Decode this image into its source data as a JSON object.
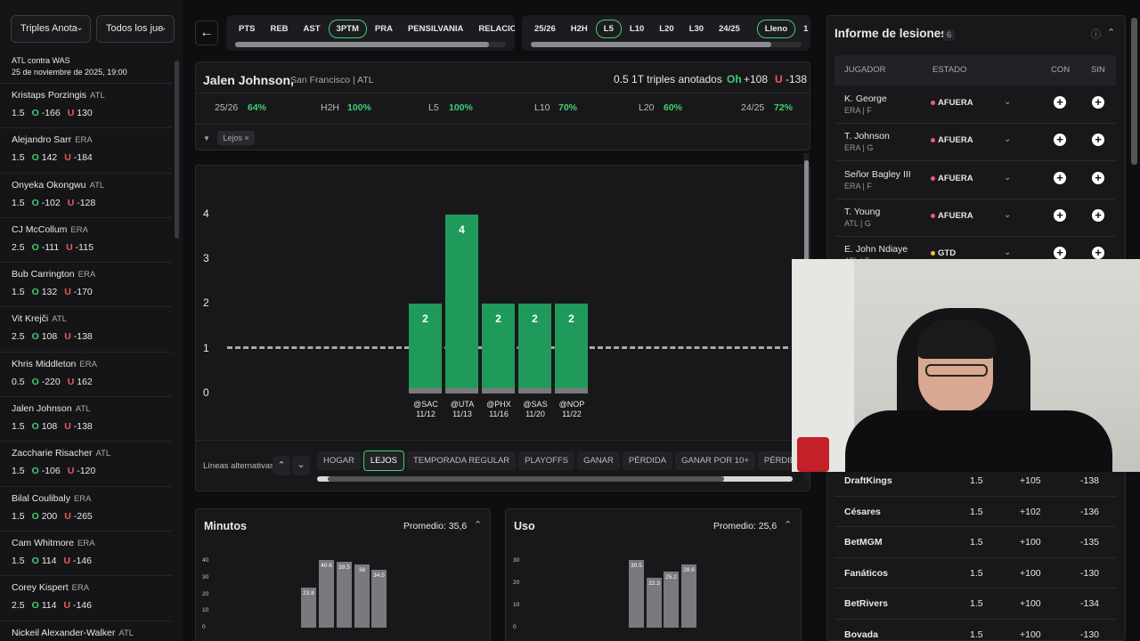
{
  "left": {
    "filter1": "Triples Anota",
    "filter2": "Todos los jue",
    "game": "ATL contra WAS",
    "game_time": "25 de noviembre de 2025, 19:00",
    "players": [
      {
        "name": "Kristaps Porzingis",
        "team": "ATL",
        "line": "1.5",
        "over": "-166",
        "under": "130"
      },
      {
        "name": "Alejandro Sarr",
        "team": "ERA",
        "line": "1.5",
        "over": "142",
        "under": "-184"
      },
      {
        "name": "Onyeka Okongwu",
        "team": "ATL",
        "line": "1.5",
        "over": "-102",
        "under": "-128"
      },
      {
        "name": "CJ McCollum",
        "team": "ERA",
        "line": "2.5",
        "over": "-111",
        "under": "-115"
      },
      {
        "name": "Bub Carrington",
        "team": "ERA",
        "line": "1.5",
        "over": "132",
        "under": "-170"
      },
      {
        "name": "Vit Krejči",
        "team": "ATL",
        "line": "2.5",
        "over": "108",
        "under": "-138"
      },
      {
        "name": "Khris Middleton",
        "team": "ERA",
        "line": "0.5",
        "over": "-220",
        "under": "162"
      },
      {
        "name": "Jalen Johnson",
        "team": "ATL",
        "line": "1.5",
        "over": "108",
        "under": "-138"
      },
      {
        "name": "Zaccharie Risacher",
        "team": "ATL",
        "line": "1.5",
        "over": "-106",
        "under": "-120"
      },
      {
        "name": "Bilal Coulibaly",
        "team": "ERA",
        "line": "1.5",
        "over": "200",
        "under": "-265"
      },
      {
        "name": "Cam Whitmore",
        "team": "ERA",
        "line": "1.5",
        "over": "114",
        "under": "-146"
      },
      {
        "name": "Corey Kispert",
        "team": "ERA",
        "line": "2.5",
        "over": "114",
        "under": "-146"
      },
      {
        "name": "Nickeil Alexander-Walker",
        "team": "ATL",
        "line": "",
        "over": "",
        "under": ""
      }
    ]
  },
  "stat_tabs": [
    "PTS",
    "REB",
    "AST",
    "3PTM",
    "PRA",
    "PENSILVANIA",
    "RELACIONES I"
  ],
  "stat_active": "3PTM",
  "range_tabs": [
    "25/26",
    "H2H",
    "L5",
    "L10",
    "L20",
    "L30",
    "24/25"
  ],
  "range_active": "L5",
  "mode_tabs": [
    "Lleno",
    "1 ho"
  ],
  "mode_active": "Lleno",
  "player": {
    "name": "Jalen Johnson,",
    "sub": "San Francisco | ATL",
    "prop": "0.5 1T triples anotados",
    "o_label": "Oh",
    "o_val": "+108",
    "u_label": "U",
    "u_val": "-138"
  },
  "hits": [
    {
      "k": "25/26",
      "v": "64%"
    },
    {
      "k": "H2H",
      "v": "100%"
    },
    {
      "k": "L5",
      "v": "100%"
    },
    {
      "k": "L10",
      "v": "70%"
    },
    {
      "k": "L20",
      "v": "60%"
    },
    {
      "k": "24/25",
      "v": "72%"
    }
  ],
  "active_filter": "Lejos",
  "filter_x": "×",
  "chart_data": {
    "type": "bar",
    "categories": [
      "@SAC 11/12",
      "@UTA 11/13",
      "@PHX 11/16",
      "@SAS 11/20",
      "@NOP 11/22"
    ],
    "values": [
      2,
      4,
      2,
      2,
      2
    ],
    "yticks": [
      "4",
      "3",
      "2",
      "1",
      "0"
    ],
    "ylim": [
      0,
      4
    ],
    "line": 0.5
  },
  "opp": [
    [
      "@SAC",
      "11/12"
    ],
    [
      "@UTA",
      "11/13"
    ],
    [
      "@PHX",
      "11/16"
    ],
    [
      "@SAS",
      "11/20"
    ],
    [
      "@NOP",
      "11/22"
    ]
  ],
  "alt_label": "Líneas alternativas",
  "split_tabs": [
    "HOGAR",
    "LEJOS",
    "TEMPORADA REGULAR",
    "PLAYOFFS",
    "GANAR",
    "PÉRDIDA",
    "GANAR POR 10+",
    "PÉRDIDA POR 10+"
  ],
  "split_active": "LEJOS",
  "minutes": {
    "title": "Minutos",
    "avg": "Promedio: 35,6",
    "values": [
      23.8,
      40.6,
      39.5,
      38,
      34.5
    ],
    "yticks": [
      "40",
      "30",
      "20",
      "10",
      "0"
    ]
  },
  "usage": {
    "title": "Uso",
    "avg": "Promedio: 25,6",
    "values": [
      30.5,
      22.3,
      25.2,
      28.6
    ],
    "yticks": [
      "30",
      "20",
      "10",
      "0"
    ]
  },
  "injury": {
    "title": "Informe de lesiones",
    "count": "6",
    "cols": [
      "JUGADOR",
      "ESTADO",
      "CON",
      "SIN"
    ],
    "rows": [
      {
        "name": "K. George",
        "team": "ERA | F",
        "status": "AFUERA",
        "color": "#f05a7a"
      },
      {
        "name": "T. Johnson",
        "team": "ERA | G",
        "status": "AFUERA",
        "color": "#f05a7a"
      },
      {
        "name": "Señor Bagley III",
        "team": "ERA | F",
        "status": "AFUERA",
        "color": "#f05a7a"
      },
      {
        "name": "T. Young",
        "team": "ATL | G",
        "status": "AFUERA",
        "color": "#f05a7a"
      },
      {
        "name": "E. John Ndiaye",
        "team": "ATL | F",
        "status": "GTD",
        "color": "#f0c040"
      }
    ]
  },
  "books": [
    {
      "name": "DraftKings",
      "line": "1.5",
      "over": "+105",
      "under": "-138"
    },
    {
      "name": "Césares",
      "line": "1.5",
      "over": "+102",
      "under": "-136"
    },
    {
      "name": "BetMGM",
      "line": "1.5",
      "over": "+100",
      "under": "-135"
    },
    {
      "name": "Fanáticos",
      "line": "1.5",
      "over": "+100",
      "under": "-130"
    },
    {
      "name": "BetRivers",
      "line": "1.5",
      "over": "+100",
      "under": "-134"
    },
    {
      "name": "Bovada",
      "line": "1.5",
      "over": "+100",
      "under": "-130"
    }
  ],
  "icons": {
    "chev": "⌄",
    "up": "⌃",
    "back": "←",
    "filter": "▼",
    "info": "ⓘ"
  }
}
